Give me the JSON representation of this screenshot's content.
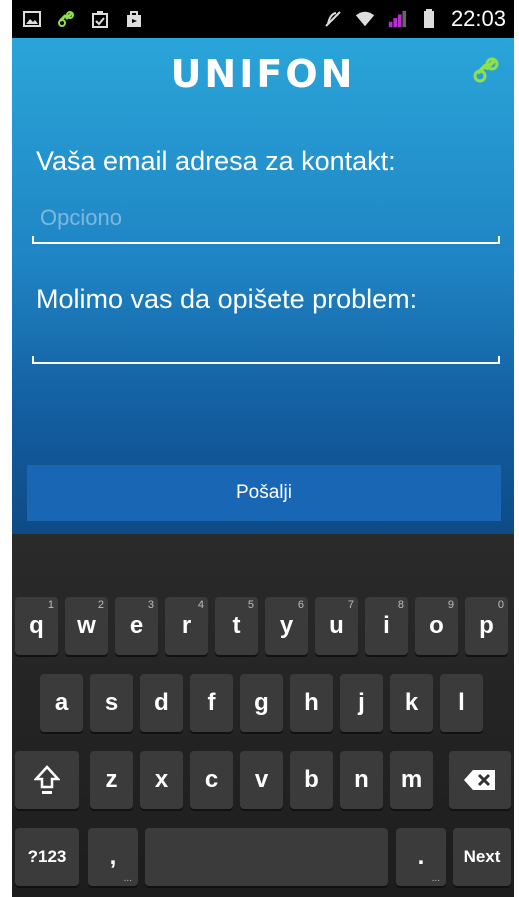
{
  "status_bar": {
    "time": "22:03",
    "left_icons": [
      "image-icon",
      "link-icon",
      "clipboard-check-icon",
      "store-icon"
    ],
    "right_icons": [
      "mute-icon",
      "wifi-icon",
      "signal-icon",
      "battery-icon"
    ]
  },
  "app": {
    "logo": "UNIFON",
    "email_label": "Vaša email adresa za kontakt:",
    "email_placeholder": "Opciono",
    "email_value": "",
    "problem_label": "Molimo vas da opišete problem:",
    "problem_value": "",
    "send_label": "Pošalji",
    "colors": {
      "accent": "#1866b4",
      "link_icon": "#8fe04a"
    }
  },
  "keyboard": {
    "row1": [
      {
        "key": "q",
        "hint": "1"
      },
      {
        "key": "w",
        "hint": "2"
      },
      {
        "key": "e",
        "hint": "3"
      },
      {
        "key": "r",
        "hint": "4"
      },
      {
        "key": "t",
        "hint": "5"
      },
      {
        "key": "y",
        "hint": "6"
      },
      {
        "key": "u",
        "hint": "7"
      },
      {
        "key": "i",
        "hint": "8"
      },
      {
        "key": "o",
        "hint": "9"
      },
      {
        "key": "p",
        "hint": "0"
      }
    ],
    "row2": [
      "a",
      "s",
      "d",
      "f",
      "g",
      "h",
      "j",
      "k",
      "l"
    ],
    "row3": [
      "z",
      "x",
      "c",
      "v",
      "b",
      "n",
      "m"
    ],
    "symbols_label": "?123",
    "comma_label": ",",
    "period_label": ".",
    "next_label": "Next"
  }
}
